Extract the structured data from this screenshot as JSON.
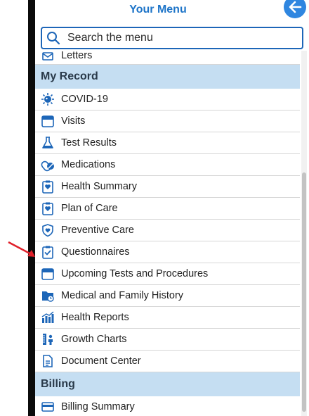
{
  "header": {
    "title": "Your Menu"
  },
  "search": {
    "placeholder": "Search the menu"
  },
  "menu": {
    "partial_item": "Letters",
    "sections": [
      {
        "title": "My Record",
        "items": [
          {
            "label": "COVID-19",
            "icon": "virus-icon"
          },
          {
            "label": "Visits",
            "icon": "calendar-icon"
          },
          {
            "label": "Test Results",
            "icon": "flask-icon"
          },
          {
            "label": "Medications",
            "icon": "pills-icon"
          },
          {
            "label": "Health Summary",
            "icon": "clipboard-heart-icon"
          },
          {
            "label": "Plan of Care",
            "icon": "clipboard-heart-icon"
          },
          {
            "label": "Preventive Care",
            "icon": "shield-heart-icon"
          },
          {
            "label": "Questionnaires",
            "icon": "clipboard-check-icon"
          },
          {
            "label": "Upcoming Tests and Procedures",
            "icon": "calendar-icon"
          },
          {
            "label": "Medical and Family History",
            "icon": "folder-clock-icon"
          },
          {
            "label": "Health Reports",
            "icon": "bar-chart-icon"
          },
          {
            "label": "Growth Charts",
            "icon": "growth-chart-icon"
          },
          {
            "label": "Document Center",
            "icon": "document-icon"
          }
        ]
      },
      {
        "title": "Billing",
        "items": [
          {
            "label": "Billing Summary",
            "icon": "billing-icon"
          }
        ]
      }
    ]
  },
  "colors": {
    "accent": "#1d74c8",
    "section_bg": "#c5def2",
    "annotation_arrow": "#e0202a"
  }
}
